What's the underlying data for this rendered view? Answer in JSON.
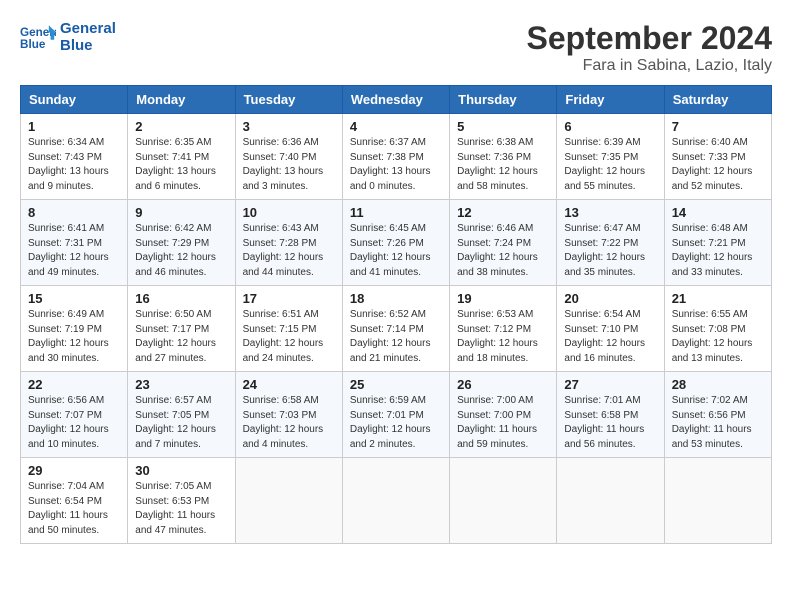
{
  "logo": {
    "line1": "General",
    "line2": "Blue"
  },
  "title": "September 2024",
  "location": "Fara in Sabina, Lazio, Italy",
  "headers": [
    "Sunday",
    "Monday",
    "Tuesday",
    "Wednesday",
    "Thursday",
    "Friday",
    "Saturday"
  ],
  "weeks": [
    [
      {
        "day": "1",
        "info": "Sunrise: 6:34 AM\nSunset: 7:43 PM\nDaylight: 13 hours\nand 9 minutes."
      },
      {
        "day": "2",
        "info": "Sunrise: 6:35 AM\nSunset: 7:41 PM\nDaylight: 13 hours\nand 6 minutes."
      },
      {
        "day": "3",
        "info": "Sunrise: 6:36 AM\nSunset: 7:40 PM\nDaylight: 13 hours\nand 3 minutes."
      },
      {
        "day": "4",
        "info": "Sunrise: 6:37 AM\nSunset: 7:38 PM\nDaylight: 13 hours\nand 0 minutes."
      },
      {
        "day": "5",
        "info": "Sunrise: 6:38 AM\nSunset: 7:36 PM\nDaylight: 12 hours\nand 58 minutes."
      },
      {
        "day": "6",
        "info": "Sunrise: 6:39 AM\nSunset: 7:35 PM\nDaylight: 12 hours\nand 55 minutes."
      },
      {
        "day": "7",
        "info": "Sunrise: 6:40 AM\nSunset: 7:33 PM\nDaylight: 12 hours\nand 52 minutes."
      }
    ],
    [
      {
        "day": "8",
        "info": "Sunrise: 6:41 AM\nSunset: 7:31 PM\nDaylight: 12 hours\nand 49 minutes."
      },
      {
        "day": "9",
        "info": "Sunrise: 6:42 AM\nSunset: 7:29 PM\nDaylight: 12 hours\nand 46 minutes."
      },
      {
        "day": "10",
        "info": "Sunrise: 6:43 AM\nSunset: 7:28 PM\nDaylight: 12 hours\nand 44 minutes."
      },
      {
        "day": "11",
        "info": "Sunrise: 6:45 AM\nSunset: 7:26 PM\nDaylight: 12 hours\nand 41 minutes."
      },
      {
        "day": "12",
        "info": "Sunrise: 6:46 AM\nSunset: 7:24 PM\nDaylight: 12 hours\nand 38 minutes."
      },
      {
        "day": "13",
        "info": "Sunrise: 6:47 AM\nSunset: 7:22 PM\nDaylight: 12 hours\nand 35 minutes."
      },
      {
        "day": "14",
        "info": "Sunrise: 6:48 AM\nSunset: 7:21 PM\nDaylight: 12 hours\nand 33 minutes."
      }
    ],
    [
      {
        "day": "15",
        "info": "Sunrise: 6:49 AM\nSunset: 7:19 PM\nDaylight: 12 hours\nand 30 minutes."
      },
      {
        "day": "16",
        "info": "Sunrise: 6:50 AM\nSunset: 7:17 PM\nDaylight: 12 hours\nand 27 minutes."
      },
      {
        "day": "17",
        "info": "Sunrise: 6:51 AM\nSunset: 7:15 PM\nDaylight: 12 hours\nand 24 minutes."
      },
      {
        "day": "18",
        "info": "Sunrise: 6:52 AM\nSunset: 7:14 PM\nDaylight: 12 hours\nand 21 minutes."
      },
      {
        "day": "19",
        "info": "Sunrise: 6:53 AM\nSunset: 7:12 PM\nDaylight: 12 hours\nand 18 minutes."
      },
      {
        "day": "20",
        "info": "Sunrise: 6:54 AM\nSunset: 7:10 PM\nDaylight: 12 hours\nand 16 minutes."
      },
      {
        "day": "21",
        "info": "Sunrise: 6:55 AM\nSunset: 7:08 PM\nDaylight: 12 hours\nand 13 minutes."
      }
    ],
    [
      {
        "day": "22",
        "info": "Sunrise: 6:56 AM\nSunset: 7:07 PM\nDaylight: 12 hours\nand 10 minutes."
      },
      {
        "day": "23",
        "info": "Sunrise: 6:57 AM\nSunset: 7:05 PM\nDaylight: 12 hours\nand 7 minutes."
      },
      {
        "day": "24",
        "info": "Sunrise: 6:58 AM\nSunset: 7:03 PM\nDaylight: 12 hours\nand 4 minutes."
      },
      {
        "day": "25",
        "info": "Sunrise: 6:59 AM\nSunset: 7:01 PM\nDaylight: 12 hours\nand 2 minutes."
      },
      {
        "day": "26",
        "info": "Sunrise: 7:00 AM\nSunset: 7:00 PM\nDaylight: 11 hours\nand 59 minutes."
      },
      {
        "day": "27",
        "info": "Sunrise: 7:01 AM\nSunset: 6:58 PM\nDaylight: 11 hours\nand 56 minutes."
      },
      {
        "day": "28",
        "info": "Sunrise: 7:02 AM\nSunset: 6:56 PM\nDaylight: 11 hours\nand 53 minutes."
      }
    ],
    [
      {
        "day": "29",
        "info": "Sunrise: 7:04 AM\nSunset: 6:54 PM\nDaylight: 11 hours\nand 50 minutes."
      },
      {
        "day": "30",
        "info": "Sunrise: 7:05 AM\nSunset: 6:53 PM\nDaylight: 11 hours\nand 47 minutes."
      },
      {
        "day": "",
        "info": ""
      },
      {
        "day": "",
        "info": ""
      },
      {
        "day": "",
        "info": ""
      },
      {
        "day": "",
        "info": ""
      },
      {
        "day": "",
        "info": ""
      }
    ]
  ]
}
